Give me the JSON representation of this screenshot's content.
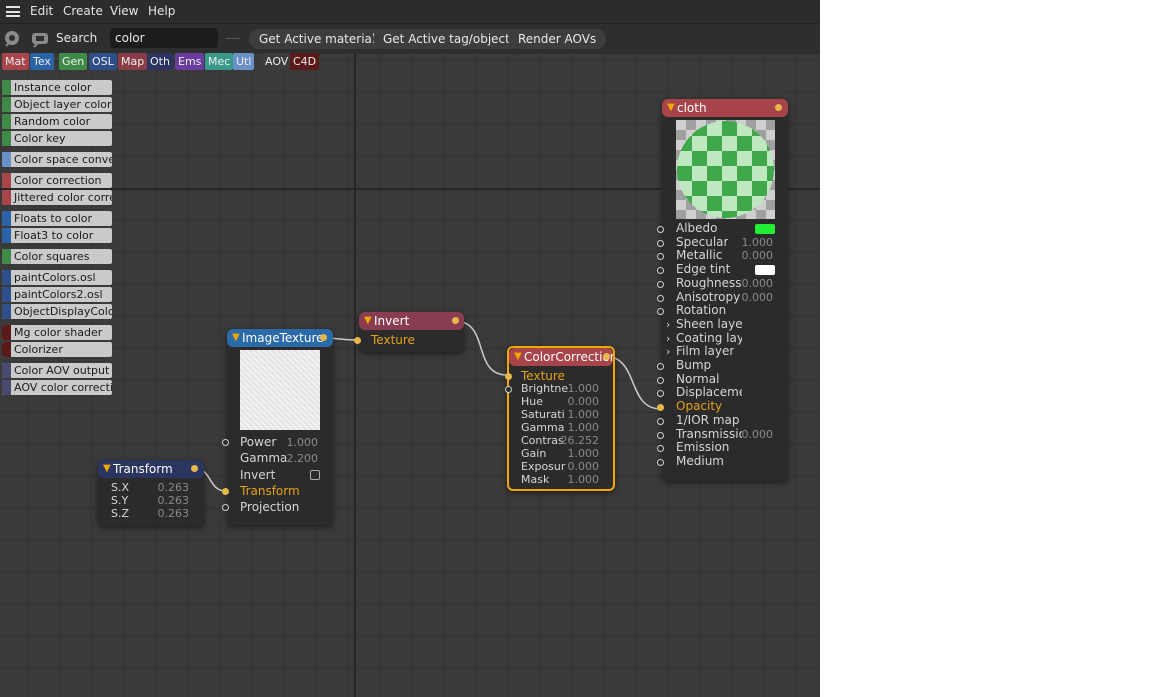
{
  "menu": {
    "items": [
      "Edit",
      "Create",
      "View",
      "Help"
    ]
  },
  "toolbar": {
    "search_label": "Search",
    "search_value": "color",
    "buttons": [
      "Get Active material",
      "Get Active tag/object",
      "Render AOVs"
    ]
  },
  "categories": [
    {
      "label": "Mat",
      "color": "#a8454b"
    },
    {
      "label": "Tex",
      "color": "#2b62a8"
    },
    {
      "label": "Gen",
      "color": "#3f8a49"
    },
    {
      "label": "OSL",
      "color": "#2f4f8a"
    },
    {
      "label": "Map",
      "color": "#8a3d47"
    },
    {
      "label": "Oth",
      "color": "#2c3560"
    },
    {
      "label": "Ems",
      "color": "#6b3ca0"
    },
    {
      "label": "Mec",
      "color": "#3a9a8a"
    },
    {
      "label": "Utl",
      "color": "#6a90c8"
    },
    {
      "label": "AOV",
      "color": "#3c3c3c"
    },
    {
      "label": "C4D",
      "color": "#5a1a1a"
    }
  ],
  "library": [
    {
      "label": "Instance color",
      "color": "#3f8a49"
    },
    {
      "label": "Object layer color",
      "color": "#3f8a49"
    },
    {
      "label": "Random color",
      "color": "#3f8a49"
    },
    {
      "label": "Color key",
      "color": "#3f8a49"
    },
    {
      "label": "Color space conve",
      "color": "#6a90c8"
    },
    {
      "label": "Color correction",
      "color": "#a8454b"
    },
    {
      "label": "Jittered color corre",
      "color": "#a8454b"
    },
    {
      "label": "Floats to color",
      "color": "#2b62a8"
    },
    {
      "label": "Float3 to color",
      "color": "#2b62a8"
    },
    {
      "label": "Color squares",
      "color": "#3f8a49"
    },
    {
      "label": "paintColors.osl",
      "color": "#2f4f8a"
    },
    {
      "label": "paintColors2.osl",
      "color": "#2f4f8a"
    },
    {
      "label": "ObjectDisplayColo",
      "color": "#2f4f8a"
    },
    {
      "label": "Mg color shader",
      "color": "#5a1a1a"
    },
    {
      "label": "Colorizer",
      "color": "#5a1a1a"
    },
    {
      "label": "Color AOV output",
      "color": "#4a4a70"
    },
    {
      "label": "AOV color correcti",
      "color": "#4a4a70"
    }
  ],
  "nodes": {
    "image_texture": {
      "title": "ImageTexture",
      "color": "#2b6aa8",
      "params": [
        {
          "label": "Power",
          "value": "1.000"
        },
        {
          "label": "Gamma",
          "value": "2.200"
        },
        {
          "label": "Invert",
          "value": ""
        },
        {
          "label": "Transform",
          "value": ""
        },
        {
          "label": "Projection",
          "value": ""
        }
      ]
    },
    "transform": {
      "title": "Transform",
      "color": "#2c3560",
      "params": [
        {
          "label": "S.X",
          "value": "0.263"
        },
        {
          "label": "S.Y",
          "value": "0.263"
        },
        {
          "label": "S.Z",
          "value": "0.263"
        }
      ]
    },
    "invert": {
      "title": "Invert",
      "color": "#8a3d50",
      "params": [
        {
          "label": "Texture"
        }
      ]
    },
    "color_correction": {
      "title": "ColorCorrection",
      "color": "#a8454b",
      "params": [
        {
          "label": "Texture",
          "value": ""
        },
        {
          "label": "Brightne",
          "value": "1.000"
        },
        {
          "label": "Hue",
          "value": "0.000"
        },
        {
          "label": "Saturati",
          "value": "1.000"
        },
        {
          "label": "Gamma",
          "value": "1.000"
        },
        {
          "label": "Contras",
          "value": "26.252"
        },
        {
          "label": "Gain",
          "value": "1.000"
        },
        {
          "label": "Exposur",
          "value": "0.000"
        },
        {
          "label": "Mask",
          "value": "1.000"
        }
      ]
    },
    "cloth": {
      "title": "cloth",
      "color": "#a8454b",
      "params": [
        {
          "label": "Albedo",
          "value": "",
          "swatch": "#22ee33"
        },
        {
          "label": "Specular",
          "value": "1.000"
        },
        {
          "label": "Metallic",
          "value": "0.000"
        },
        {
          "label": "Edge tint",
          "value": "",
          "swatch": "#ffffff"
        },
        {
          "label": "Roughness",
          "value": "0.000"
        },
        {
          "label": "Anisotropy",
          "value": "0.000"
        },
        {
          "label": "Rotation",
          "value": ""
        },
        {
          "label": "Sheen layer",
          "value": ""
        },
        {
          "label": "Coating layer",
          "value": ""
        },
        {
          "label": "Film layer",
          "value": ""
        },
        {
          "label": "Bump",
          "value": ""
        },
        {
          "label": "Normal",
          "value": ""
        },
        {
          "label": "Displacement",
          "value": ""
        },
        {
          "label": "Opacity",
          "value": ""
        },
        {
          "label": "1/IOR map",
          "value": ""
        },
        {
          "label": "Transmissio",
          "value": "0.000"
        },
        {
          "label": "Emission",
          "value": ""
        },
        {
          "label": "Medium",
          "value": ""
        }
      ]
    }
  },
  "colors": {
    "accent": "#e6b84a",
    "wire": "#cccccc",
    "selected_outline": "#f0a800"
  }
}
